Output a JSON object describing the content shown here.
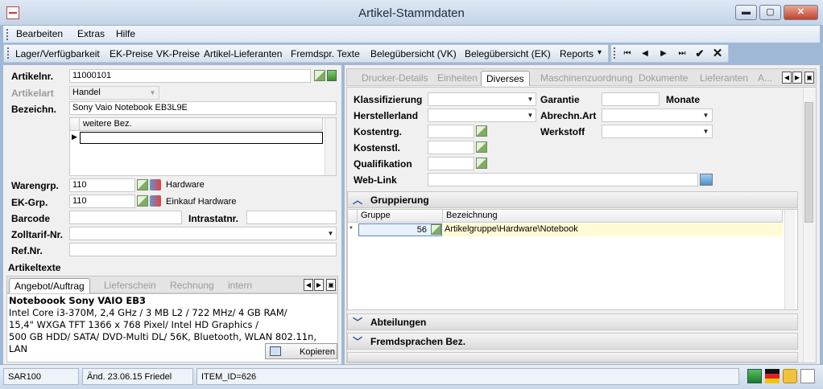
{
  "window": {
    "title": "Artikel-Stammdaten",
    "min": "▬",
    "max": "▢",
    "close": "✕"
  },
  "menu": {
    "items": [
      "Bearbeiten",
      "Extras",
      "Hilfe"
    ]
  },
  "toolbar": {
    "items": [
      "Lager/Verfügbarkeit",
      "EK-Preise",
      "VK-Preise",
      "Artikel-Lieferanten",
      "Fremdspr. Texte",
      "Belegübersicht (VK)",
      "Belegübersicht (EK)",
      "Reports"
    ],
    "reports_arrow": "▾"
  },
  "nav": {
    "first": "⏮",
    "prev": "◀",
    "next": "▶",
    "last": "⏭",
    "ok": "✔",
    "cancel": "✕"
  },
  "article": {
    "nr_label": "Artikelnr.",
    "nr": "11000101",
    "art_label": "Artikelart",
    "art": "Handel",
    "bez_label": "Bezeichn.",
    "bez": "Sony Vaio Notebook EB3L9E",
    "weitere_bez_header": "weitere Bez.",
    "warengrp_label": "Warengrp.",
    "warengrp": "110",
    "warengrp_text": "Hardware",
    "ekgrp_label": "EK-Grp.",
    "ekgrp": "110",
    "ekgrp_text": "Einkauf Hardware",
    "barcode_label": "Barcode",
    "intrastat_label": "Intrastatnr.",
    "zolltarif_label": "Zolltarif-Nr.",
    "refnr_label": "Ref.Nr.",
    "artikeltexte_label": "Artikeltexte"
  },
  "text_tabs": [
    "Angebot/Auftrag",
    "Lieferschein",
    "Rechnung",
    "intern"
  ],
  "article_text": {
    "line1": "Noteboook Sony VAIO EB3",
    "line2": "Intel Core i3-370M, 2,4 GHz / 3 MB L2 / 722 MHz/ 4 GB RAM/",
    "line3": "15,4\" WXGA TFT 1366 x 768 Pixel/ Intel HD Graphics /",
    "line4": "500 GB HDD/ SATA/ DVD-Multi DL/ 56K, Bluetooth, WLAN 802.11n, LAN",
    "kopieren": "Kopieren"
  },
  "right_tabs": [
    "Drucker-Details",
    "Einheiten",
    "Diverses",
    "Maschinenzuordnung",
    "Dokumente",
    "Lieferanten",
    "A..."
  ],
  "active_right_tab": "Diverses",
  "diverses": {
    "klassifizierung": "Klassifizierung",
    "herstellerland": "Herstellerland",
    "kostentrg": "Kostentrg.",
    "kostenstl": "Kostenstl.",
    "qualifikation": "Qualifikation",
    "weblink": "Web-Link",
    "garantie": "Garantie",
    "monate": "Monate",
    "abrechn": "Abrechn.Art",
    "werkstoff": "Werkstoff"
  },
  "gruppierung": {
    "title": "Gruppierung",
    "col_gruppe": "Gruppe",
    "col_bez": "Bezeichnung",
    "row_marker": "*",
    "row_gruppe": "56",
    "row_bez": "Artikelgruppe\\Hardware\\Notebook"
  },
  "sections": {
    "abteilungen": "Abteilungen",
    "fremdsprachen": "Fremdsprachen Bez."
  },
  "status": {
    "user": "SAR100",
    "changed": "Änd. 23.06.15 Friedel",
    "item": "ITEM_ID=626"
  }
}
